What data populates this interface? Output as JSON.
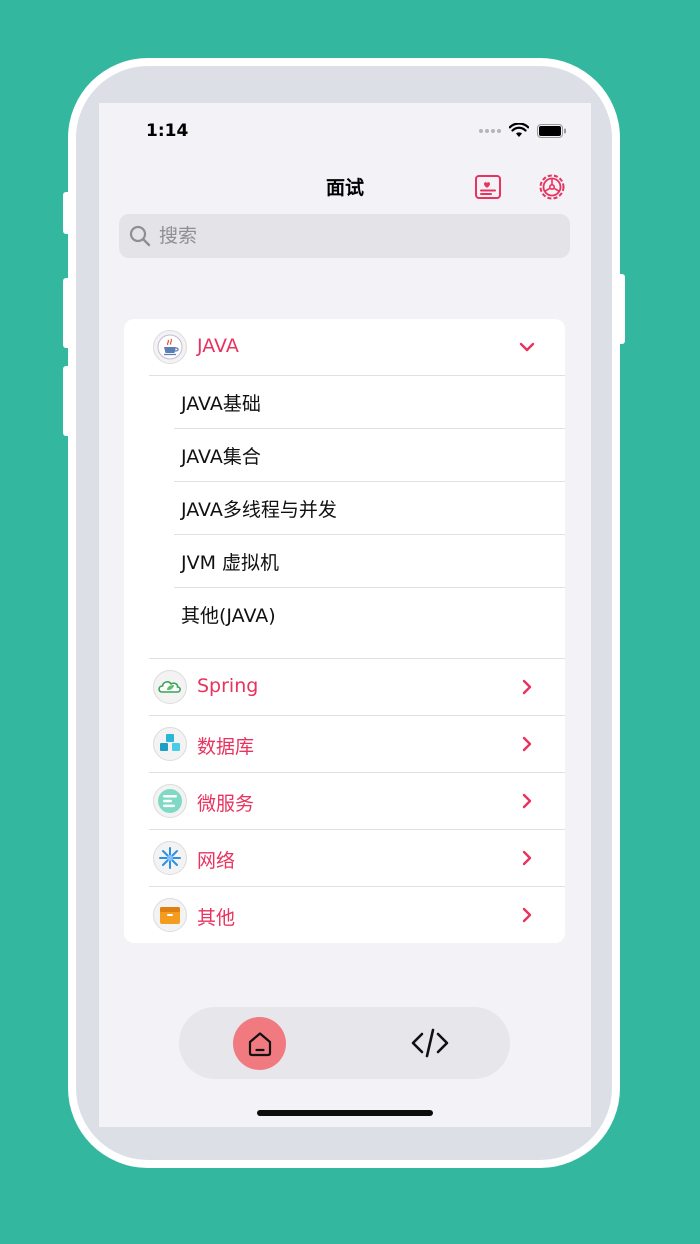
{
  "status_bar": {
    "time": "1:14"
  },
  "nav": {
    "title": "面试",
    "favorites_icon": "bookmark-card-icon",
    "settings_icon": "settings-gear-icon"
  },
  "search": {
    "placeholder": "搜索",
    "value": ""
  },
  "categories": [
    {
      "label": "JAVA",
      "icon": "java-coffee-icon",
      "expanded": true,
      "children": [
        "JAVA基础",
        "JAVA集合",
        "JAVA多线程与并发",
        "JVM 虚拟机",
        "其他(JAVA)"
      ]
    },
    {
      "label": "Spring",
      "icon": "spring-cloud-leaf-icon",
      "expanded": false
    },
    {
      "label": "数据库",
      "icon": "database-cubes-icon",
      "expanded": false
    },
    {
      "label": "微服务",
      "icon": "microservice-bars-icon",
      "expanded": false
    },
    {
      "label": "网络",
      "icon": "network-burst-icon",
      "expanded": false
    },
    {
      "label": "其他",
      "icon": "other-box-icon",
      "expanded": false
    }
  ],
  "tabbar": {
    "tabs": [
      {
        "icon": "home-icon",
        "selected": true
      },
      {
        "icon": "code-icon",
        "selected": false
      }
    ]
  },
  "colors": {
    "accent": "#e8335f",
    "background": "#33b89f",
    "tab_selected": "#f07a7f"
  }
}
